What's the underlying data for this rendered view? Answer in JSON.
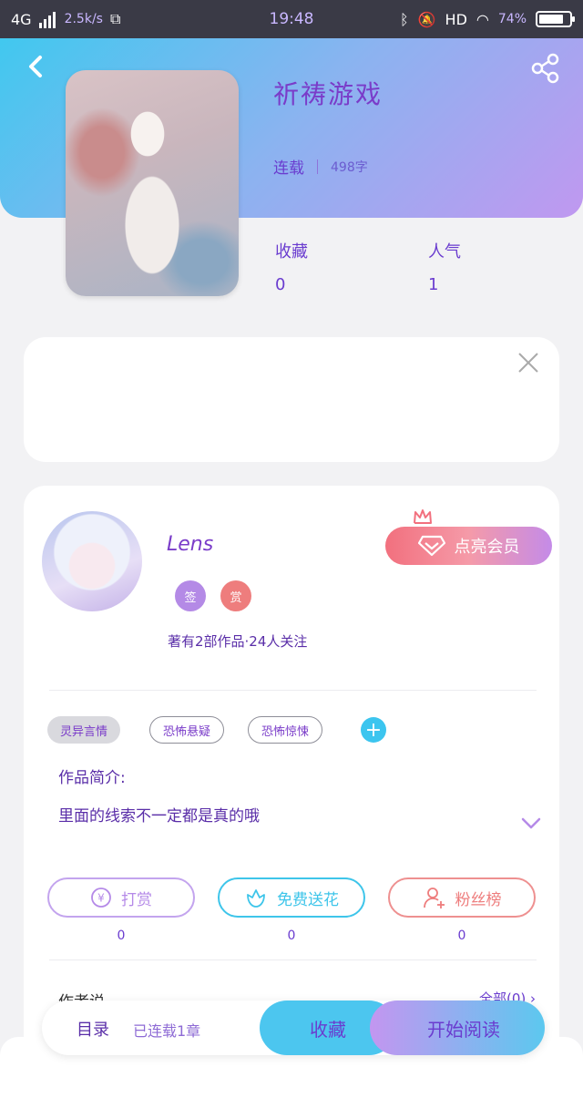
{
  "status_bar": {
    "network": "4G",
    "speed": "2.5k/s",
    "time": "19:48",
    "hd": "HD",
    "battery": "74%"
  },
  "book": {
    "title": "祈祷游戏",
    "status": "连载",
    "word_count": "498字",
    "collect_label": "收藏",
    "collect_count": "0",
    "popularity_label": "人气",
    "popularity_count": "1"
  },
  "author": {
    "name": "Lens",
    "badges": [
      "签",
      "赏"
    ],
    "stats": "著有2部作品·24人关注",
    "vip_button": "点亮会员"
  },
  "tags": [
    "灵异言情",
    "恐怖悬疑",
    "恐怖惊悚"
  ],
  "intro": {
    "label": "作品简介:",
    "text": "里面的线索不一定都是真的哦"
  },
  "actions": [
    {
      "label": "打赏",
      "count": "0",
      "icon": "yen-coin-icon",
      "color": "#b58ae8"
    },
    {
      "label": "免费送花",
      "count": "0",
      "icon": "flower-icon",
      "color": "#3ec5ea"
    },
    {
      "label": "粉丝榜",
      "count": "0",
      "icon": "fan-rank-icon",
      "color": "#ee7d7d"
    }
  ],
  "author_say": {
    "label": "作者说",
    "see_all": "全部(0)"
  },
  "bottom_bar": {
    "toc": "目录",
    "chapter_status": "已连载1章",
    "collect": "收藏",
    "read": "开始阅读"
  },
  "colors": {
    "accent_purple": "#7a3cc9",
    "accent_blue": "#41c8ef",
    "vip_pink": "#f2707e"
  }
}
